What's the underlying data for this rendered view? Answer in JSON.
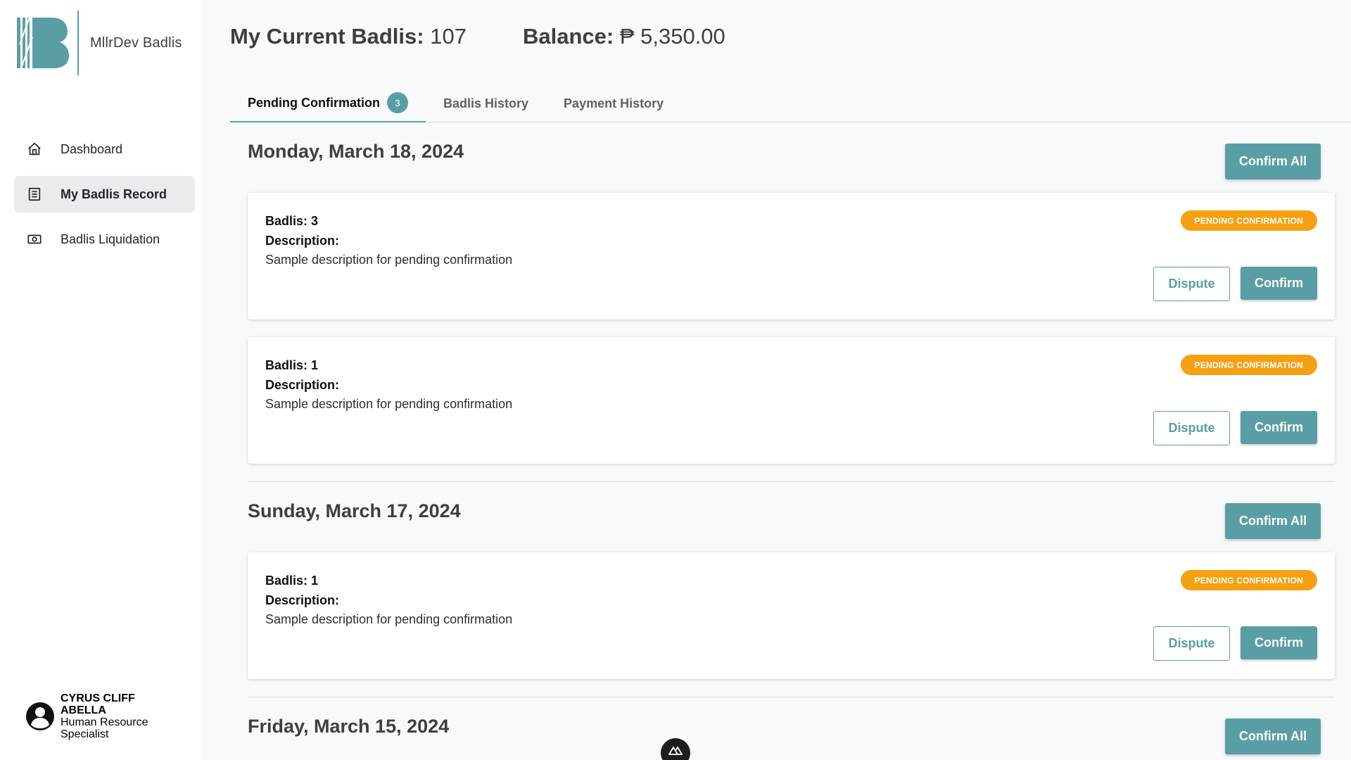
{
  "brand": {
    "name": "MllrDev Badlis",
    "accent": "#5a9ea5"
  },
  "sidebar": {
    "items": [
      {
        "label": "Dashboard",
        "icon": "home-icon"
      },
      {
        "label": "My Badlis Record",
        "icon": "document-icon",
        "active": true
      },
      {
        "label": "Badlis Liquidation",
        "icon": "cash-icon"
      }
    ]
  },
  "profile": {
    "name": "CYRUS CLIFF ABELLA",
    "role": "Human Resource Specialist"
  },
  "stats": {
    "badlis_label": "My Current Badlis:",
    "badlis_value": "107",
    "balance_label": "Balance:",
    "balance_value": "₱ 5,350.00"
  },
  "tabs": [
    {
      "label": "Pending Confirmation",
      "badge": "3",
      "active": true
    },
    {
      "label": "Badlis History"
    },
    {
      "label": "Payment History"
    }
  ],
  "labels": {
    "confirm_all": "Confirm All",
    "status": "PENDING CONFIRMATION",
    "dispute": "Dispute",
    "confirm": "Confirm",
    "badlis": "Badlis:",
    "description": "Description:"
  },
  "groups": [
    {
      "date": "Monday, March 18, 2024",
      "entries": [
        {
          "badlis": "3",
          "description": "Sample description for pending confirmation"
        },
        {
          "badlis": "1",
          "description": "Sample description for pending confirmation"
        }
      ]
    },
    {
      "date": "Sunday, March 17, 2024",
      "entries": [
        {
          "badlis": "1",
          "description": "Sample description for pending confirmation"
        }
      ]
    },
    {
      "date": "Friday, March 15, 2024",
      "entries": []
    }
  ]
}
